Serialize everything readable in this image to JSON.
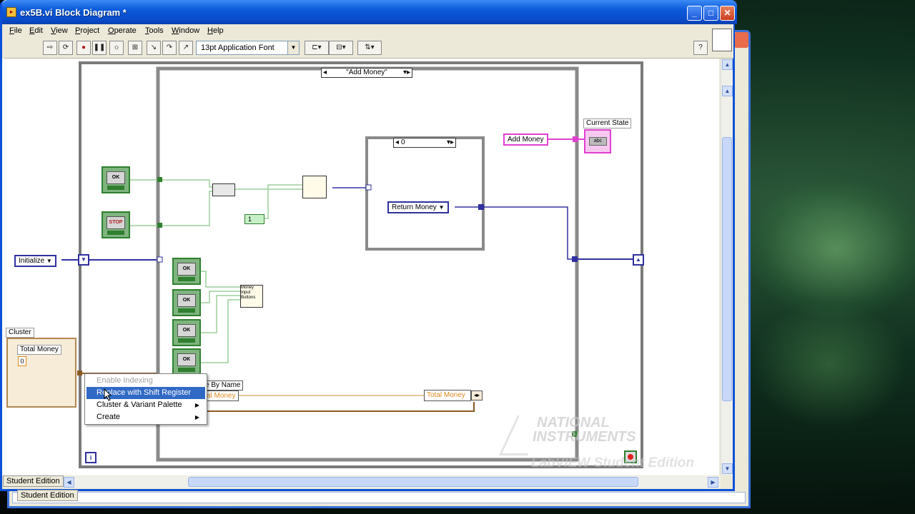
{
  "window": {
    "title": "ex5B.vi Block Diagram *"
  },
  "menu": [
    "File",
    "Edit",
    "View",
    "Project",
    "Operate",
    "Tools",
    "Window",
    "Help"
  ],
  "toolbar": {
    "font": "13pt Application Font"
  },
  "diagram": {
    "outer_case_selector": "\"Add Money\"",
    "inner_case_selector": "0",
    "initialize_const": "Initialize",
    "return_money_const": "Return Money",
    "add_money_const": "Add Money",
    "current_state_label": "Current State",
    "cluster_label": "Cluster",
    "total_money_label": "Total Money",
    "total_money_value": "0",
    "unbundle_label": "e By Name",
    "unbundle_item": "al Money",
    "bundle_item": "Total Money",
    "ok_button": "OK",
    "stop_button": "STOP",
    "numeric_const": "1",
    "node_text": "Money Input Buttons"
  },
  "context_menu": {
    "items": [
      {
        "label": "Enable Indexing",
        "state": "disabled"
      },
      {
        "label": "Replace with Shift Register",
        "state": "selected"
      },
      {
        "label": "Cluster & Variant Palette",
        "state": "submenu"
      },
      {
        "label": "Create",
        "state": "submenu"
      }
    ]
  },
  "watermark": {
    "line1": "NATIONAL",
    "line2": "INSTRUMENTS",
    "line3": "LabVIEW Student Edition"
  },
  "status": {
    "student_edition": "Student Edition"
  },
  "colors": {
    "title_blue": "#0b5ad9",
    "enum_wire": "#3030a0",
    "string_wire": "#e040d0",
    "bool_wire": "#2f7f2f",
    "cluster_wire": "#8a5a20",
    "menu_highlight": "#316ac5"
  }
}
